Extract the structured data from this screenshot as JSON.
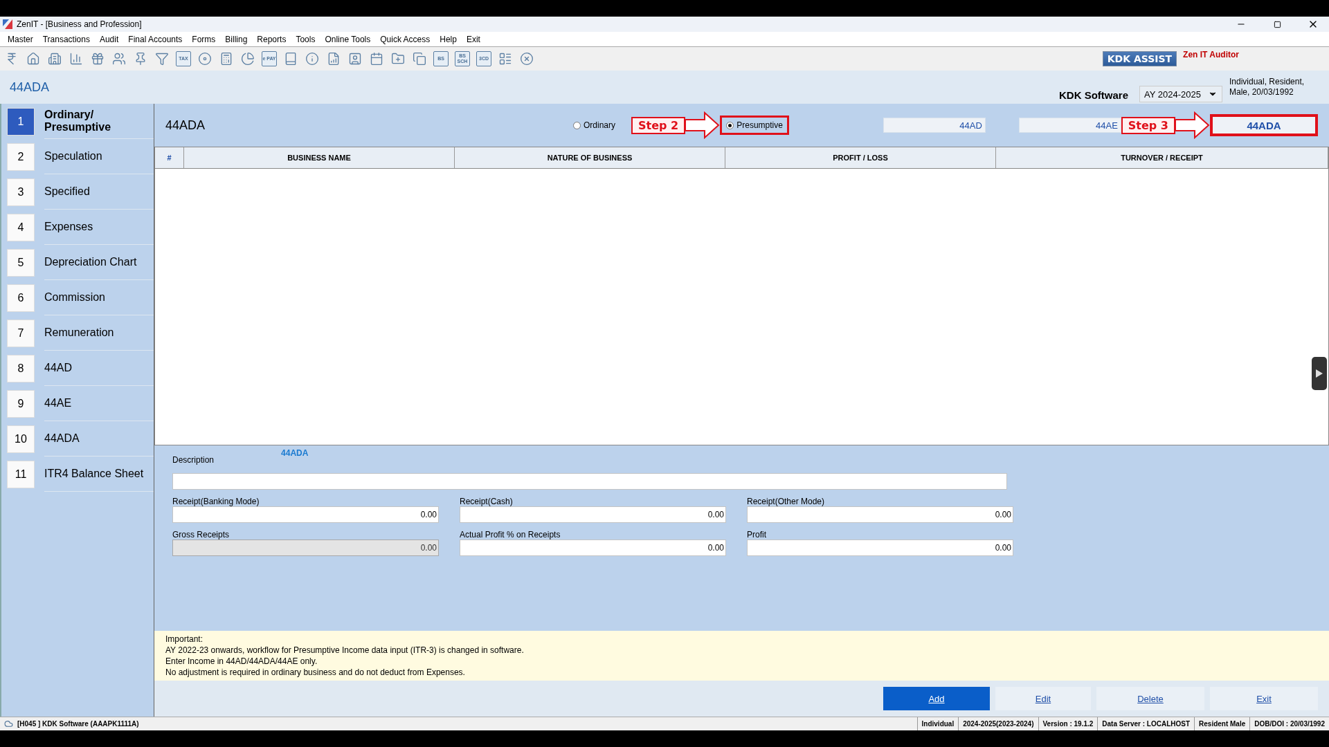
{
  "window": {
    "title": "ZenIT - [Business and Profession]"
  },
  "menu": [
    "Master",
    "Transactions",
    "Audit",
    "Final Accounts",
    "Forms",
    "Billing",
    "Reports",
    "Tools",
    "Online Tools",
    "Quick Access",
    "Help",
    "Exit"
  ],
  "toolbar": [
    {
      "kind": "rupee"
    },
    {
      "kind": "home"
    },
    {
      "kind": "building"
    },
    {
      "kind": "chart"
    },
    {
      "kind": "gift"
    },
    {
      "kind": "users"
    },
    {
      "kind": "pin"
    },
    {
      "kind": "filter"
    },
    {
      "kind": "text",
      "label": "TAX"
    },
    {
      "kind": "disc"
    },
    {
      "kind": "calculator"
    },
    {
      "kind": "pie"
    },
    {
      "kind": "text",
      "label": "e PAY"
    },
    {
      "kind": "book"
    },
    {
      "kind": "info"
    },
    {
      "kind": "report"
    },
    {
      "kind": "user"
    },
    {
      "kind": "calendar"
    },
    {
      "kind": "folder"
    },
    {
      "kind": "copy"
    },
    {
      "kind": "text",
      "label": "BS"
    },
    {
      "kind": "text",
      "label": "BS SCH"
    },
    {
      "kind": "text",
      "label": "3CD"
    },
    {
      "kind": "layout"
    },
    {
      "kind": "close"
    }
  ],
  "assist": {
    "button": "KDK ASSIST",
    "auditor": "Zen IT Auditor"
  },
  "header": {
    "title": "44ADA",
    "company": "KDK Software",
    "year": "AY 2024-2025",
    "profile_line1": "Individual, Resident,",
    "profile_line2": "Male, 20/03/1992"
  },
  "sidebar": [
    {
      "number": "1",
      "label": "Ordinary/ Presumptive",
      "selected": true
    },
    {
      "number": "2",
      "label": "Speculation",
      "selected": false
    },
    {
      "number": "3",
      "label": "Specified",
      "selected": false
    },
    {
      "number": "4",
      "label": "Expenses",
      "selected": false
    },
    {
      "number": "5",
      "label": "Depreciation Chart",
      "selected": false
    },
    {
      "number": "6",
      "label": "Commission",
      "selected": false
    },
    {
      "number": "7",
      "label": "Remuneration",
      "selected": false
    },
    {
      "number": "8",
      "label": "44AD",
      "selected": false
    },
    {
      "number": "9",
      "label": "44AE",
      "selected": false
    },
    {
      "number": "10",
      "label": "44ADA",
      "selected": false
    },
    {
      "number": "11",
      "label": "ITR4 Balance Sheet",
      "selected": false
    }
  ],
  "panel": {
    "title": "44ADA",
    "radios": [
      {
        "label": "Ordinary",
        "selected": false,
        "highlighted": false
      },
      {
        "label": "Presumptive",
        "selected": true,
        "highlighted": true,
        "step": "Step 2"
      }
    ],
    "tabs": [
      {
        "label": "44AD",
        "selected": false,
        "highlighted": false
      },
      {
        "label": "44AE",
        "selected": false,
        "highlighted": false
      },
      {
        "label": "44ADA",
        "selected": true,
        "highlighted": true,
        "step": "Step 3"
      }
    ]
  },
  "table": {
    "columns": [
      "#",
      "BUSINESS NAME",
      "NATURE OF BUSINESS",
      "PROFIT / LOSS",
      "TURNOVER / RECEIPT"
    ]
  },
  "form": {
    "description_label": "Description",
    "section": "44ADA",
    "fields": [
      {
        "label": "Receipt(Banking Mode)",
        "value": "0.00",
        "disabled": false
      },
      {
        "label": "Receipt(Cash)",
        "value": "0.00",
        "disabled": false
      },
      {
        "label": "Receipt(Other Mode)",
        "value": "0.00",
        "disabled": false
      },
      {
        "label": "Gross Receipts",
        "value": "0.00",
        "disabled": true
      },
      {
        "label": "Actual Profit % on Receipts",
        "value": "0.00",
        "disabled": false
      },
      {
        "label": "Profit",
        "value": "0.00",
        "disabled": false
      }
    ]
  },
  "notice": [
    "Important:",
    "AY 2022-23 onwards, workflow for Presumptive Income data input (ITR-3) is changed in software.",
    "Enter Income in 44AD/44ADA/44AE only.",
    "No adjustment is required in ordinary business and do not deduct from Expenses."
  ],
  "buttons": [
    {
      "label": "Add",
      "selected": true
    },
    {
      "label": "Edit",
      "selected": false
    },
    {
      "label": "Delete",
      "selected": false
    },
    {
      "label": "Exit",
      "selected": false
    }
  ],
  "status_bar": [
    "[H045 ] KDK Software (AAAPK1111A)",
    "Individual",
    "2024-2025(2023-2024)",
    "Version : 19.1.2",
    "Data Server : LOCALHOST",
    "Resident Male",
    "DOB/DOI : 20/03/1992"
  ]
}
